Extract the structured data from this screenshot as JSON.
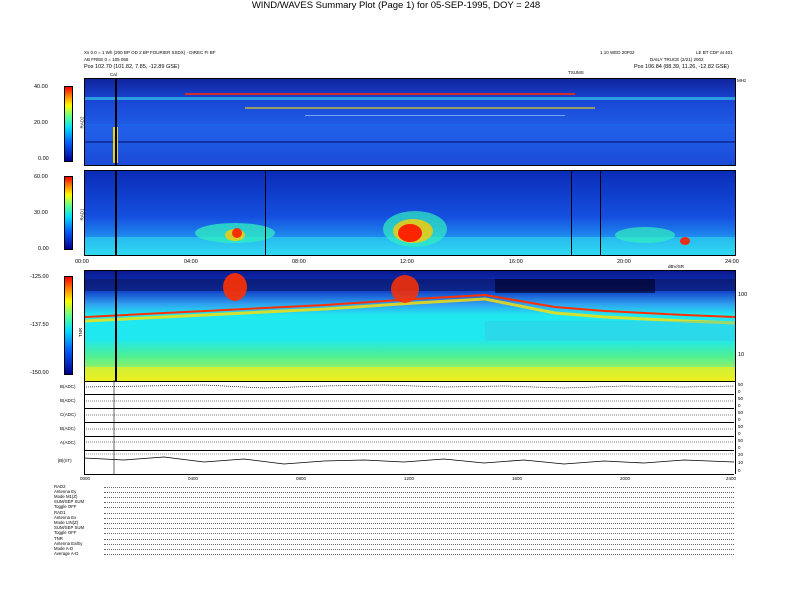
{
  "header": {
    "title": "WIND/WAVES Summary Plot (Page 1) for 05-SEP-1995, DOY = 248",
    "left_line1": "Xs  0.0 = 1 Wh (200 BP OD 2 BP FOURIER SSDX) - DIREC FI BF",
    "left_line2": "AB FREE 0 = 105 055",
    "left_line3": "Pos  102.70 (101.82, 7.85, -12.89 GSE)",
    "right_line1": "LE BT   CDF   at  401",
    "right_line2": "DAILY  TRUCE (2/21) 2002",
    "right_line3": "Pos  106.84 (88.39, 11.26, -12.82 GSE)",
    "center_small": "1.10 WED 20F02",
    "time_label": "TSUMS",
    "cal_label": "Cal"
  },
  "chart_data": [
    {
      "type": "heatmap",
      "panel": "RAD2",
      "ylabel": "RAD2",
      "colorbar_ticks": [
        "40.00",
        "20.00",
        "0.00"
      ],
      "colorbar_range": [
        0,
        40
      ],
      "ylim": [
        0,
        40
      ],
      "right_label": "MHz"
    },
    {
      "type": "heatmap",
      "panel": "RAD1",
      "ylabel": "RAD1",
      "colorbar_ticks": [
        "60.00",
        "30.00",
        "0.00"
      ],
      "colorbar_range": [
        0,
        60
      ],
      "ylim": [
        0,
        60
      ],
      "x_ticks": [
        "00:00",
        "04:00",
        "08:00",
        "12:00",
        "16:00",
        "20:00",
        "24:00"
      ],
      "xlim": [
        "00:00",
        "24:00"
      ]
    },
    {
      "type": "heatmap",
      "panel": "TNR",
      "ylabel": "TNR",
      "colorbar_ticks": [
        "-125.00",
        "-137.50",
        "-150.00"
      ],
      "colorbar_range": [
        -150,
        -125
      ],
      "right_ticks": [
        "100",
        "10"
      ],
      "right_top_label": "dBV/SR"
    },
    {
      "type": "line",
      "traces": [
        {
          "name": "B(ADC)",
          "right_ticks": [
            "50",
            "0",
            "-50"
          ]
        },
        {
          "name": "B(ADC)",
          "right_ticks": [
            "50",
            "0",
            "-50"
          ]
        },
        {
          "name": "C(ADC)",
          "right_ticks": [
            "50",
            "0",
            "-50"
          ]
        },
        {
          "name": "B(ADC)",
          "right_ticks": [
            "50",
            "0",
            "-50"
          ]
        },
        {
          "name": "A(ADC)",
          "right_ticks": [
            "50",
            "0",
            "-50"
          ]
        },
        {
          "name": "|B|(nT)",
          "right_ticks": [
            "20",
            "10",
            "0"
          ]
        }
      ],
      "x_ticks": [
        "0000",
        "0400",
        "0800",
        "1200",
        "1600",
        "2000",
        "2400"
      ]
    }
  ],
  "settings": {
    "rows": [
      {
        "label": "RAD2",
        "value": ""
      },
      {
        "label": "Antenna",
        "value": "Ey"
      },
      {
        "label": "Mode",
        "value": "M1(Z)"
      },
      {
        "label": "SUM/SEP",
        "value": "SUM"
      },
      {
        "label": "Toggle",
        "value": "OFF"
      },
      {
        "label": "RAD1",
        "value": ""
      },
      {
        "label": "Antenna",
        "value": "Ex"
      },
      {
        "label": "Mode",
        "value": "LIN(Z)"
      },
      {
        "label": "SUM/SEP",
        "value": "SUM"
      },
      {
        "label": "Toggle",
        "value": "OFF"
      },
      {
        "label": "TNR",
        "value": ""
      },
      {
        "label": "Antenna",
        "value": "Ex/Ey"
      },
      {
        "label": "Mode",
        "value": "A-D"
      },
      {
        "label": "Average",
        "value": "A-D"
      }
    ]
  }
}
